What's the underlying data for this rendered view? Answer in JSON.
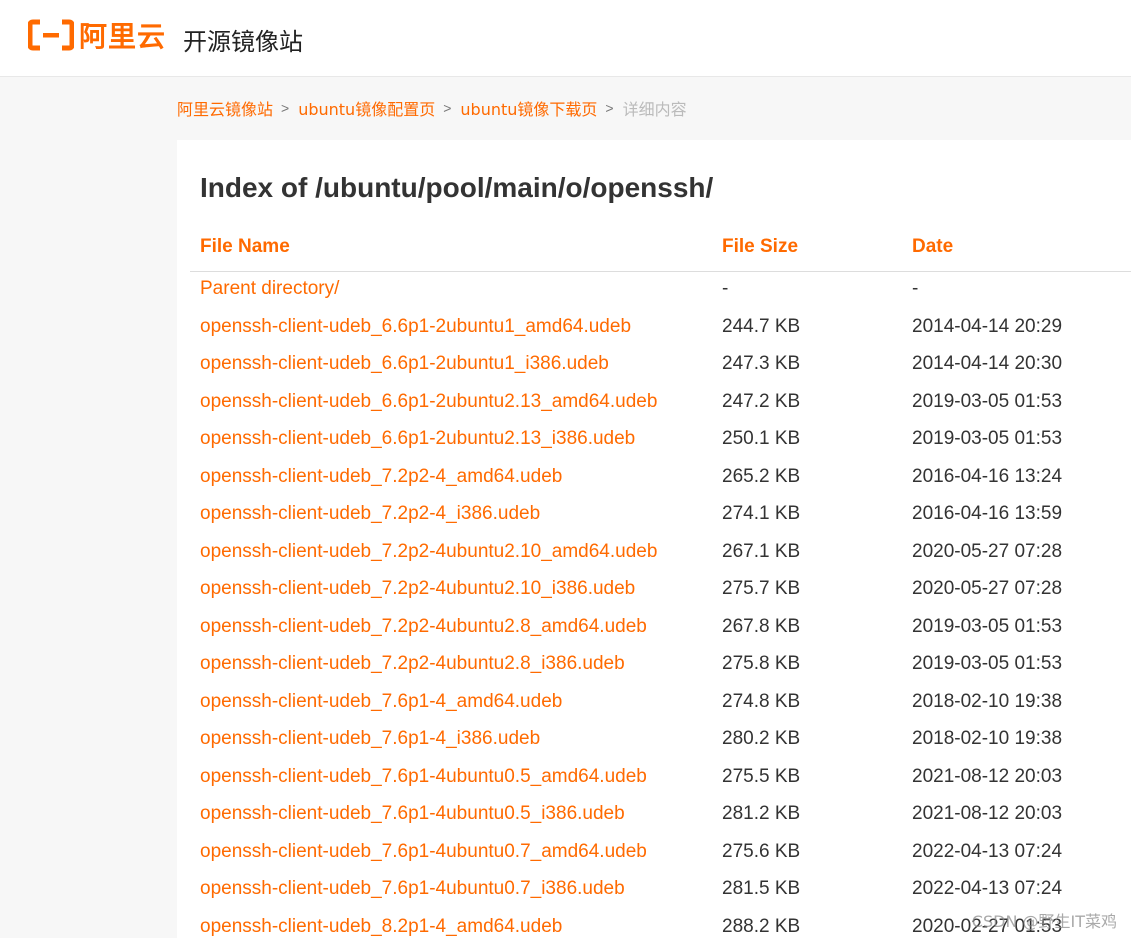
{
  "header": {
    "logo_text": "阿里云",
    "site_title": "开源镜像站"
  },
  "breadcrumb": {
    "items": [
      "阿里云镜像站",
      "ubuntu镜像配置页",
      "ubuntu镜像下载页"
    ],
    "separator": ">",
    "current": "详细内容"
  },
  "listing": {
    "title": "Index of /ubuntu/pool/main/o/openssh/",
    "columns": {
      "name": "File Name",
      "size": "File Size",
      "date": "Date"
    },
    "rows": [
      {
        "name": "Parent directory/",
        "size": "-",
        "date": "-"
      },
      {
        "name": "openssh-client-udeb_6.6p1-2ubuntu1_amd64.udeb",
        "size": "244.7 KB",
        "date": "2014-04-14 20:29"
      },
      {
        "name": "openssh-client-udeb_6.6p1-2ubuntu1_i386.udeb",
        "size": "247.3 KB",
        "date": "2014-04-14 20:30"
      },
      {
        "name": "openssh-client-udeb_6.6p1-2ubuntu2.13_amd64.udeb",
        "size": "247.2 KB",
        "date": "2019-03-05 01:53"
      },
      {
        "name": "openssh-client-udeb_6.6p1-2ubuntu2.13_i386.udeb",
        "size": "250.1 KB",
        "date": "2019-03-05 01:53"
      },
      {
        "name": "openssh-client-udeb_7.2p2-4_amd64.udeb",
        "size": "265.2 KB",
        "date": "2016-04-16 13:24"
      },
      {
        "name": "openssh-client-udeb_7.2p2-4_i386.udeb",
        "size": "274.1 KB",
        "date": "2016-04-16 13:59"
      },
      {
        "name": "openssh-client-udeb_7.2p2-4ubuntu2.10_amd64.udeb",
        "size": "267.1 KB",
        "date": "2020-05-27 07:28"
      },
      {
        "name": "openssh-client-udeb_7.2p2-4ubuntu2.10_i386.udeb",
        "size": "275.7 KB",
        "date": "2020-05-27 07:28"
      },
      {
        "name": "openssh-client-udeb_7.2p2-4ubuntu2.8_amd64.udeb",
        "size": "267.8 KB",
        "date": "2019-03-05 01:53"
      },
      {
        "name": "openssh-client-udeb_7.2p2-4ubuntu2.8_i386.udeb",
        "size": "275.8 KB",
        "date": "2019-03-05 01:53"
      },
      {
        "name": "openssh-client-udeb_7.6p1-4_amd64.udeb",
        "size": "274.8 KB",
        "date": "2018-02-10 19:38"
      },
      {
        "name": "openssh-client-udeb_7.6p1-4_i386.udeb",
        "size": "280.2 KB",
        "date": "2018-02-10 19:38"
      },
      {
        "name": "openssh-client-udeb_7.6p1-4ubuntu0.5_amd64.udeb",
        "size": "275.5 KB",
        "date": "2021-08-12 20:03"
      },
      {
        "name": "openssh-client-udeb_7.6p1-4ubuntu0.5_i386.udeb",
        "size": "281.2 KB",
        "date": "2021-08-12 20:03"
      },
      {
        "name": "openssh-client-udeb_7.6p1-4ubuntu0.7_amd64.udeb",
        "size": "275.6 KB",
        "date": "2022-04-13 07:24"
      },
      {
        "name": "openssh-client-udeb_7.6p1-4ubuntu0.7_i386.udeb",
        "size": "281.5 KB",
        "date": "2022-04-13 07:24"
      },
      {
        "name": "openssh-client-udeb_8.2p1-4_amd64.udeb",
        "size": "288.2 KB",
        "date": "2020-02-27 01:53"
      }
    ]
  },
  "watermark": "CSDN @野生IT菜鸡",
  "colors": {
    "accent": "#ff6a00",
    "text": "#333333",
    "muted": "#bbbbbb",
    "background": "#f7f7f7"
  }
}
